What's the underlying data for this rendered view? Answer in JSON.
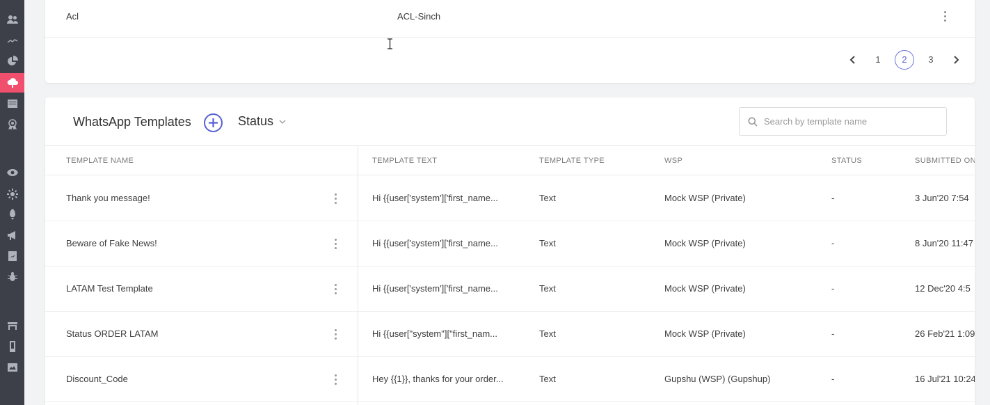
{
  "sidebar": {
    "items": [
      {
        "icon": "users-icon"
      },
      {
        "icon": "trend-icon"
      },
      {
        "icon": "pie-chart-icon"
      },
      {
        "icon": "cloud-upload-icon",
        "active": true
      },
      {
        "icon": "inbox-icon"
      },
      {
        "icon": "badge-icon"
      },
      {
        "icon": "eye-icon"
      },
      {
        "icon": "settings-icon"
      },
      {
        "icon": "rocket-icon"
      },
      {
        "icon": "megaphone-icon"
      },
      {
        "icon": "report-icon"
      },
      {
        "icon": "bug-icon"
      },
      {
        "icon": "store-icon"
      },
      {
        "icon": "phone-icon"
      },
      {
        "icon": "chart-image-icon"
      }
    ],
    "active_color": "#f0506e"
  },
  "top_card": {
    "row": {
      "name": "Acl",
      "value": "ACL-Sinch"
    },
    "pagination": {
      "pages": [
        "1",
        "2",
        "3"
      ],
      "current": "2"
    }
  },
  "templates": {
    "title": "WhatsApp Templates",
    "status_filter": "Status",
    "search_placeholder": "Search by template name",
    "columns": [
      "TEMPLATE NAME",
      "TEMPLATE TEXT",
      "TEMPLATE TYPE",
      "WSP",
      "STATUS",
      "SUBMITTED ON"
    ],
    "rows": [
      {
        "name": "Thank you message!",
        "text": "Hi {{user['system']['first_name...",
        "type": "Text",
        "wsp": "Mock WSP (Private)",
        "status": "-",
        "submitted": "3 Jun'20 7:54"
      },
      {
        "name": "Beware of Fake News!",
        "text": "Hi {{user['system']['first_name...",
        "type": "Text",
        "wsp": "Mock WSP (Private)",
        "status": "-",
        "submitted": "8 Jun'20 11:47"
      },
      {
        "name": "LATAM Test Template",
        "text": "Hi {{user['system']['first_name...",
        "type": "Text",
        "wsp": "Mock WSP (Private)",
        "status": "-",
        "submitted": "12 Dec'20 4:5"
      },
      {
        "name": "Status ORDER LATAM",
        "text": "Hi {{user[\"system\"][\"first_nam...",
        "type": "Text",
        "wsp": "Mock WSP (Private)",
        "status": "-",
        "submitted": "26 Feb'21 1:09"
      },
      {
        "name": "Discount_Code",
        "text": "Hey {{1}}, thanks for your order...",
        "type": "Text",
        "wsp": "Gupshu (WSP) (Gupshup)",
        "status": "-",
        "submitted": "16 Jul'21 10:24"
      }
    ],
    "accent_color": "#5661d4"
  }
}
